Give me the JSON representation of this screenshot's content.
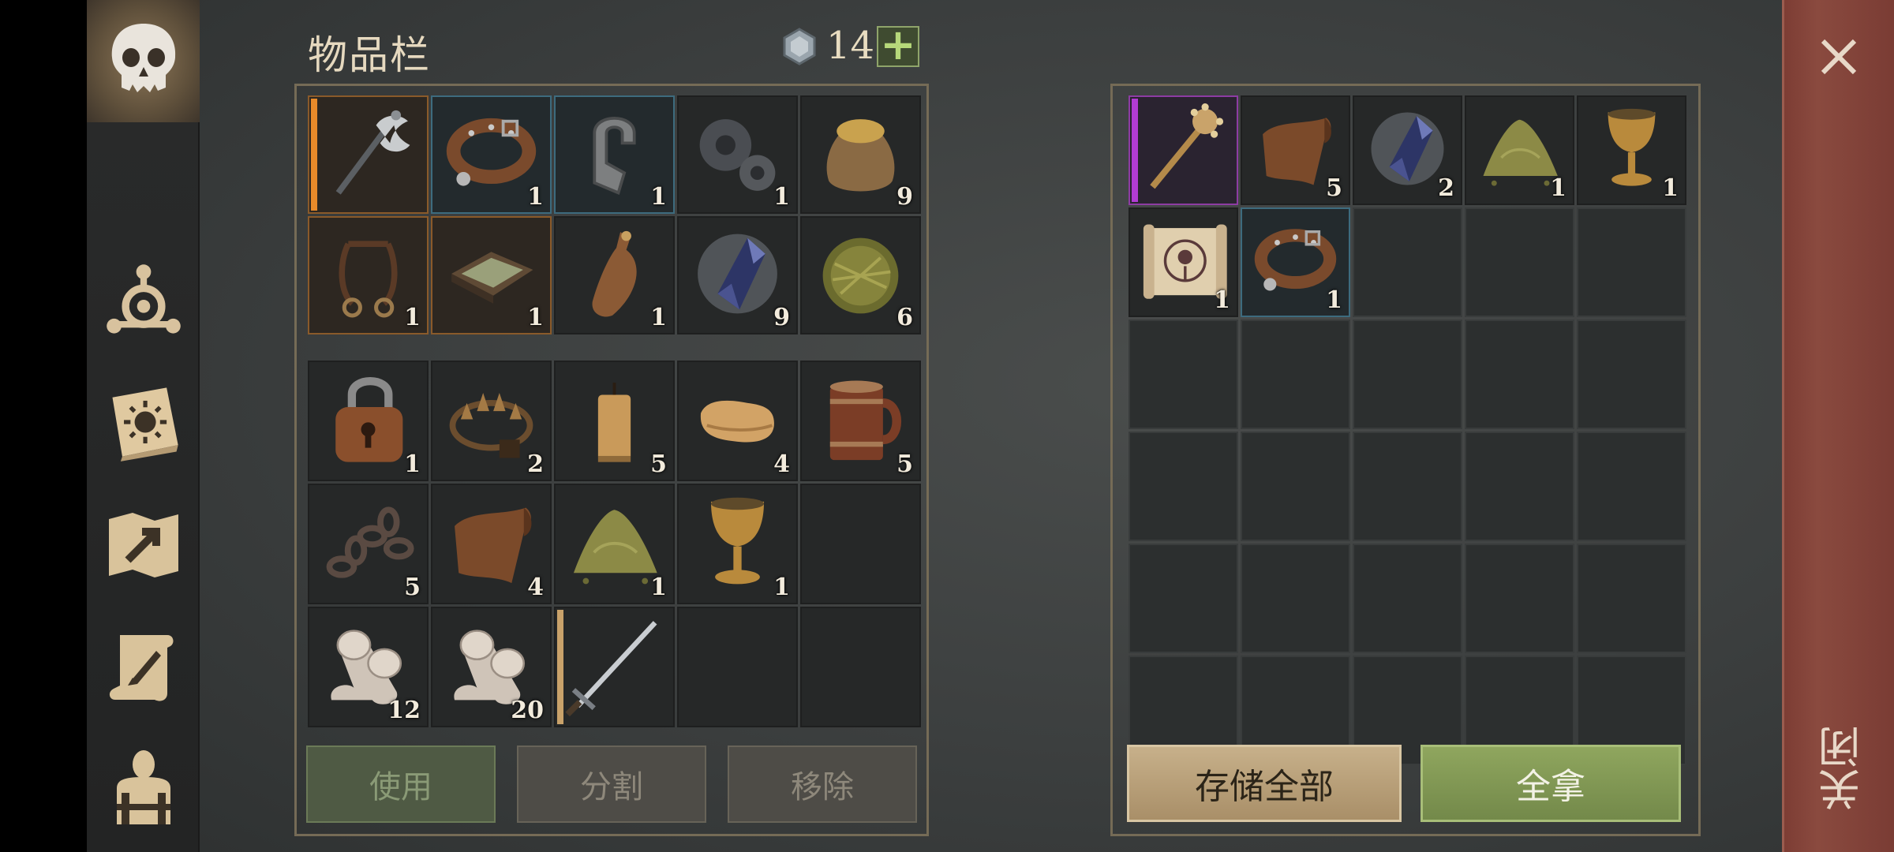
{
  "inventory": {
    "title": "物品栏",
    "currency": {
      "icon": "gem-icon",
      "count": "14"
    },
    "add_label": "+",
    "equip_row": [
      {
        "icon": "battle-axe-icon",
        "count": "",
        "rarity": "orange",
        "bar": "#e88a2a"
      },
      {
        "icon": "leather-collar-icon",
        "count": "1",
        "rarity": "blue"
      },
      {
        "icon": "metal-clamp-icon",
        "count": "1",
        "rarity": "blue"
      },
      {
        "icon": "gears-icon",
        "count": "1",
        "rarity": ""
      },
      {
        "icon": "sack-icon",
        "count": "9",
        "rarity": ""
      },
      {
        "icon": "bridle-icon",
        "count": "1",
        "rarity": "orange"
      },
      {
        "icon": "tray-icon",
        "count": "1",
        "rarity": "orange"
      },
      {
        "icon": "flask-icon",
        "count": "1",
        "rarity": ""
      },
      {
        "icon": "crystal-icon",
        "count": "9",
        "rarity": ""
      },
      {
        "icon": "herb-ball-icon",
        "count": "6",
        "rarity": ""
      }
    ],
    "bag": [
      {
        "icon": "padlock-icon",
        "count": "1"
      },
      {
        "icon": "bear-trap-icon",
        "count": "2"
      },
      {
        "icon": "candle-icon",
        "count": "5"
      },
      {
        "icon": "cloth-icon",
        "count": "4"
      },
      {
        "icon": "mug-icon",
        "count": "5"
      },
      {
        "icon": "chain-icon",
        "count": "5"
      },
      {
        "icon": "leather-icon",
        "count": "4"
      },
      {
        "icon": "powder-pile-icon",
        "count": "1"
      },
      {
        "icon": "goblet-icon",
        "count": "1"
      },
      {
        "icon": "",
        "count": ""
      },
      {
        "icon": "bandage-roll-icon",
        "count": "12"
      },
      {
        "icon": "bandage-roll-icon",
        "count": "20"
      },
      {
        "icon": "sword-icon",
        "count": "",
        "bar": "#c9a26a"
      },
      {
        "icon": "",
        "count": ""
      },
      {
        "icon": "",
        "count": ""
      }
    ],
    "buttons": {
      "use": "使用",
      "split": "分割",
      "remove": "移除"
    }
  },
  "storage": {
    "items": [
      {
        "icon": "mace-icon",
        "count": "",
        "rarity": "purple",
        "bar": "#b23cd4"
      },
      {
        "icon": "leather-icon",
        "count": "5",
        "rarity": ""
      },
      {
        "icon": "crystal-icon",
        "count": "2",
        "rarity": ""
      },
      {
        "icon": "powder-pile-icon",
        "count": "1",
        "rarity": ""
      },
      {
        "icon": "goblet-icon",
        "count": "1",
        "rarity": ""
      },
      {
        "icon": "scroll-map-icon",
        "count": "1",
        "rarity": ""
      },
      {
        "icon": "leather-collar-icon",
        "count": "1",
        "rarity": "blue"
      }
    ],
    "total_slots": 30,
    "buttons": {
      "store_all": "存储全部",
      "take_all": "全拿"
    }
  },
  "sidebar": [
    {
      "icon": "skull-icon"
    },
    {
      "icon": "crafting-icon"
    },
    {
      "icon": "book-sun-icon"
    },
    {
      "icon": "map-icon"
    },
    {
      "icon": "quest-scroll-icon"
    },
    {
      "icon": "character-icon"
    }
  ],
  "close": {
    "label": "关闭"
  }
}
